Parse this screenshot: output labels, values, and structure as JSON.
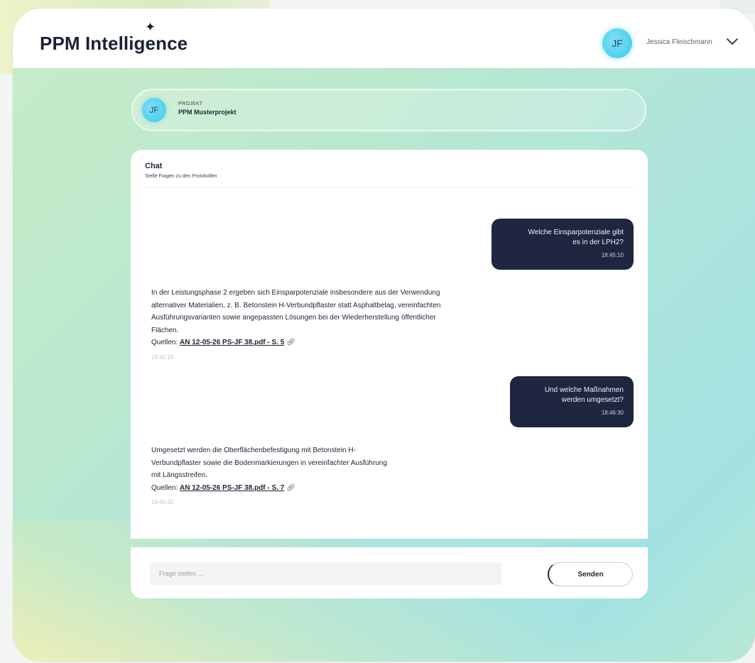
{
  "app": {
    "logo": "PPM Intelligence"
  },
  "user": {
    "initials": "JF",
    "name": "Jessica Fleischmann"
  },
  "project": {
    "initials": "JF",
    "kicker": "PROJEKT",
    "name": "PPM Musterprojekt"
  },
  "chat": {
    "title": "Chat",
    "subtitle": "Stelle Fragen zu den Protokollen",
    "messages": [
      {
        "role": "user",
        "text_line1": "Welche Einsparpotenziale gibt",
        "text_line2": "es in der LPH2?",
        "time": "18:45:10"
      },
      {
        "role": "assistant",
        "text": "In der Leistungsphase 2 ergeben sich Einsparpotenziale insbesondere aus der Verwendung alternativer Materialien, z. B. Betonstein H-Verbundpflaster statt Asphaltbelag, vereinfachten Ausführungsvarianten sowie angepassten Lösungen bei der Wiederherstellung öffentlicher Flächen.",
        "sources_label": "Quellen:",
        "source": "AN 12-05-26 PS-JF 38.pdf - S. 5",
        "time": "18:45:18"
      },
      {
        "role": "user",
        "text_line1": "Und welche Maßnahmen",
        "text_line2": "werden umgesetzt?",
        "time": "18:46:30"
      },
      {
        "role": "assistant",
        "text": "Umgesetzt werden die Oberflächenbefestigung mit Betonstein H-Verbundpflaster sowie die Bodenmarkierungen in vereinfachter Ausführung mit Längsstreifen.",
        "sources_label": "Quellen:",
        "source": "AN 12-05-26 PS-JF 38.pdf - S. 7",
        "time": "18:46:42"
      }
    ]
  },
  "composer": {
    "placeholder": "Frage stellen ...",
    "send_label": "Senden"
  },
  "icons": {
    "logo_star": "sparkle-icon",
    "user_menu": "chevron-down-icon",
    "source_link": "link-icon"
  },
  "colors": {
    "user_bubble": "#1e2640",
    "avatar": "#4fd0ee"
  }
}
